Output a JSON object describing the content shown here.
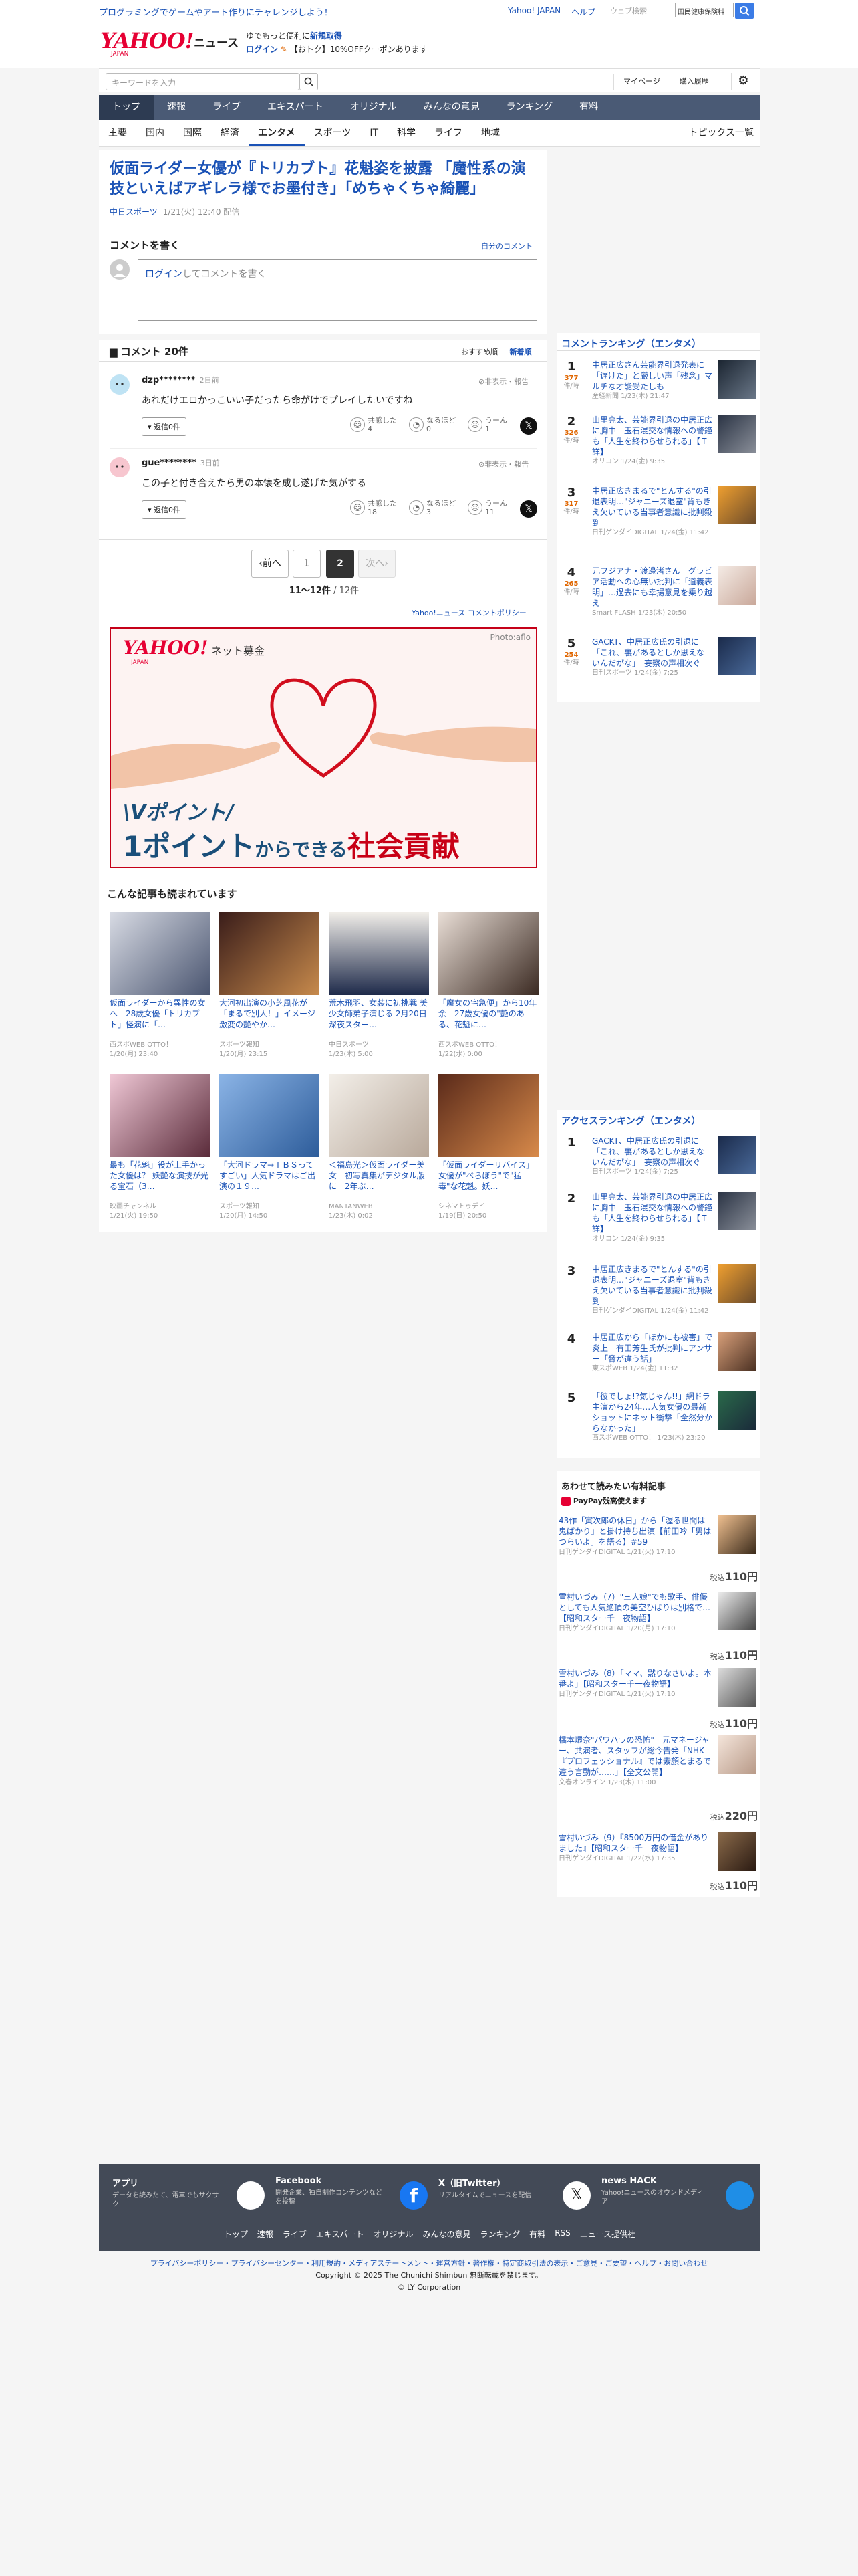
{
  "topbar": {
    "promo": "プログラミングでゲームやアート作りにチャレンジしよう！",
    "link_yahoo": "Yahoo! JAPAN",
    "link_help": "ヘルプ",
    "search_placeholder": "ウェブ検索",
    "search_suggest": "国民健康保険料"
  },
  "header": {
    "logo": "YAHOO!",
    "logo_sub": "JAPAN",
    "news": "ニュース",
    "promo_line1_a": "ゆでもっと便利に",
    "promo_line1_b": "新規取得",
    "promo_line2_a": "ログイン",
    "promo_line2_b": "【おトク】10%OFFクーポンあります"
  },
  "search": {
    "placeholder": "キーワードを入力",
    "mypage": "マイページ",
    "history": "購入履歴"
  },
  "nav": [
    "トップ",
    "速報",
    "ライブ",
    "エキスパート",
    "オリジナル",
    "みんなの意見",
    "ランキング",
    "有料"
  ],
  "subnav": [
    "主要",
    "国内",
    "国際",
    "経済",
    "エンタメ",
    "スポーツ",
    "IT",
    "科学",
    "ライフ",
    "地域"
  ],
  "subnav_topics": "トピックス一覧",
  "article": {
    "title": "仮面ライダー女優が『トリカブト』花魁姿を披露 「魔性系の演技といえばアギレラ様でお墨付き」「めちゃくちゃ綺麗」",
    "source": "中日スポーツ",
    "datetime": "1/21(火) 12:40 配信"
  },
  "comment_form": {
    "title": "コメントを書く",
    "own_comment": "自分のコメント",
    "login": "ログイン",
    "placeholder_rest": "してコメントを書く"
  },
  "comments": {
    "heading": "コメント 20件",
    "sort_recommended": "おすすめ順",
    "sort_newest": "新着順",
    "hide_label": "非表示・報告",
    "reply_label": "返信0件",
    "items": [
      {
        "user": "dzp********",
        "time": "2日前",
        "body": "あれだけエロかっこいい子だったら命がけでプレイしたいですね",
        "r1_label": "共感した",
        "r1": "4",
        "r2_label": "なるほど",
        "r2": "0",
        "r3_label": "うーん",
        "r3": "1"
      },
      {
        "user": "gue********",
        "time": "3日前",
        "body": "この子と付き合えたら男の本懐を成し遂げた気がする",
        "r1_label": "共感した",
        "r1": "18",
        "r2_label": "なるほど",
        "r2": "3",
        "r3_label": "うーん",
        "r3": "11"
      }
    ]
  },
  "pager": {
    "prev": "前へ",
    "p1": "1",
    "p2": "2",
    "next": "次へ",
    "range": "11〜12件",
    "total": "/ 12件",
    "policy": "Yahoo!ニュース コメントポリシー"
  },
  "ad": {
    "logo": "YAHOO!",
    "logo_sub": "JAPAN",
    "service": "ネット募金",
    "photo_credit": "Photo:aflo",
    "line1": "\\Vポイント/",
    "line2_a": "1ポイント",
    "line2_b": "からできる",
    "line2_c": "社会貢献"
  },
  "recommended": {
    "title": "こんな記事も読まれています",
    "items": [
      {
        "title": "仮面ライダーから異性の女へ　28歳女優「トリカブト」怪演に「…",
        "source": "西スポWEB OTTO！",
        "time": "1/20(月) 23:40"
      },
      {
        "title": "大河初出演の小芝風花が「まるで別人！」イメージ激変の艶やか…",
        "source": "スポーツ報知",
        "time": "1/20(月) 23:15"
      },
      {
        "title": "荒木飛羽、女装に初挑戦 美少女師弟子演じる 2月20日深夜スター…",
        "source": "中日スポーツ",
        "time": "1/23(木) 5:00"
      },
      {
        "title": "「魔女の宅急便」から10年余　27歳女優の\"艶のある、花魁に…",
        "source": "西スポWEB OTTO！",
        "time": "1/22(水) 0:00"
      },
      {
        "title": "最も「花魁」役が上手かった女優は？ 妖艶な演技が光る宝石（3…",
        "source": "映画チャンネル",
        "time": "1/21(火) 19:50"
      },
      {
        "title": "「大河ドラマ→ＴＢＳってすごい」人気ドラマはご出演の１９…",
        "source": "スポーツ報知",
        "time": "1/20(月) 14:50"
      },
      {
        "title": "＜福島光＞仮面ライダー美女　初写真集がデジタル版に　2年ぶ…",
        "source": "MANTANWEB",
        "time": "1/23(木) 0:02"
      },
      {
        "title": "「仮面ライダーリバイス」女優が\"ぺらぼう\"で\"猛毒\"な花魁。妖…",
        "source": "シネマトゥデイ",
        "time": "1/19(日) 20:50"
      }
    ]
  },
  "ranking_ent": {
    "title": "コメントランキング（エンタメ）",
    "unit": "件/時",
    "items": [
      {
        "num": "1",
        "count": "377",
        "title": "中居正広さん芸能界引退発表に「遅けた」と厳しい声「残念」マルチな才能受たしも",
        "source": "産経新聞",
        "time": "1/23(木) 21:47"
      },
      {
        "num": "2",
        "count": "326",
        "title": "山里亮太、芸能界引退の中居正広に胸中　玉石混交な情報への警鐘も「人生を終わらせられる」【Ｔ詳】",
        "source": "オリコン",
        "time": "1/24(金) 9:35"
      },
      {
        "num": "3",
        "count": "317",
        "title": "中居正広きまるで\"とんする\"の引退表明…\"ジャニーズ退室\"背もきえ欠いている当事者意識に批判殺到",
        "source": "日刊ゲンダイDIGITAL",
        "time": "1/24(金) 11:42"
      },
      {
        "num": "4",
        "count": "265",
        "title": "元フジアナ・渡邊渚さん　グラビア活動への心無い批判に「道義表明」…過去にも幸揚意見を乗り越え",
        "source": "Smart FLASH",
        "time": "1/23(木) 20:50"
      },
      {
        "num": "5",
        "count": "254",
        "title": "GACKT、中居正広氏の引退に「これ、裏があるとしか思えないんだがな」　妄察の声相次ぐ",
        "source": "日刊スポーツ",
        "time": "1/24(金) 7:25"
      }
    ]
  },
  "ranking_access": {
    "title": "アクセスランキング（エンタメ）",
    "items": [
      {
        "num": "1",
        "title": "GACKT、中居正広氏の引退に「これ、裏があるとしか思えないんだがな」　妄察の声相次ぐ",
        "source": "日刊スポーツ",
        "time": "1/24(金) 7:25"
      },
      {
        "num": "2",
        "title": "山里亮太、芸能界引退の中居正広に胸中　玉石混交な情報への警鐘も「人生を終わらせられる」【Ｔ詳】",
        "source": "オリコン",
        "time": "1/24(金) 9:35"
      },
      {
        "num": "3",
        "title": "中居正広きまるで\"とんする\"の引退表明…\"ジャニーズ退室\"背もきえ欠いている当事者意識に批判殺到",
        "source": "日刊ゲンダイDIGITAL",
        "time": "1/24(金) 11:42"
      },
      {
        "num": "4",
        "title": "中居正広から「ほかにも被害」で炎上　有田芳生氏が批判にアンサー「脅が違う話」",
        "source": "東スポWEB",
        "time": "1/24(金) 11:32"
      },
      {
        "num": "5",
        "title": "「彼でしょ!?気じゃん!!」網ドラ主演から24年…人気女優の最新ショットにネット衝撃「全然分からなかった」",
        "source": "西スポWEB OTTO！",
        "time": "1/23(木) 23:20"
      }
    ]
  },
  "paid": {
    "title": "あわせて読みたい有料記事",
    "paypay": "PayPay残高使えます",
    "currency_prefix": "税込",
    "items": [
      {
        "title": "43作「寅次郎の休日」から「渥る世間は鬼ばかり」と掛け持ち出演【前田吟「男はつらいよ」を語る】#59",
        "source": "日刊ゲンダイDIGITAL",
        "time": "1/21(火) 17:10",
        "price": "110円"
      },
      {
        "title": "雪村いづみ（7）\"三人娘\"でも歌手、俳優としても人気絶頂の美空ひばりは別格で…【昭和スター千一夜物語】",
        "source": "日刊ゲンダイDIGITAL",
        "time": "1/20(月) 17:10",
        "price": "110円"
      },
      {
        "title": "雪村いづみ（8）「ママ、黙りなさいよ。本番よ」【昭和スター千一夜物語】",
        "source": "日刊ゲンダイDIGITAL",
        "time": "1/21(火) 17:10",
        "price": "110円"
      },
      {
        "title": "橋本環奈\"パワハラの恐怖\"　元マネージャー、共演者、スタッフが総今告発「NHK『プロフェッショナル』では素顔とまるで違う言動が……」【全文公開】",
        "source": "文春オンライン",
        "time": "1/23(木) 11:00",
        "price": "220円"
      },
      {
        "title": "雪村いづみ（9）『8500万円の借金がありました』【昭和スター千一夜物語】",
        "source": "日刊ゲンダイDIGITAL",
        "time": "1/22(水) 17:35",
        "price": "110円"
      }
    ]
  },
  "footer": {
    "cells": [
      {
        "h": "アプリ",
        "d": "データを読みたて、電車でもサクサク"
      },
      {
        "h": "Facebook",
        "d": "開発企業、独自制作コンテンツなどを投稿"
      },
      {
        "h": "X（旧Twitter）",
        "d": "リアルタイムでニュースを配信"
      },
      {
        "h": "news HACK",
        "d": "Yahoo!ニュースのオウンドメディア"
      }
    ],
    "nav": [
      "トップ",
      "速報",
      "ライブ",
      "エキスパート",
      "オリジナル",
      "みんなの意見",
      "ランキング",
      "有料",
      "RSS",
      "ニュース提供社"
    ],
    "legal_links": "プライバシーポリシー・プライバシーセンター・利用規約・メディアステートメント・運営方針・著作権・特定商取引法の表示・ご意見・ご要望・ヘルプ・お問い合わせ",
    "copyright": "Copyright © 2025 The Chunichi Shimbun 無断転載を禁じます。",
    "corp": "© LY Corporation"
  },
  "colors": {
    "accent": "#1a52b6",
    "brand_red": "#e60033",
    "nav_bg": "#4a5a75"
  }
}
